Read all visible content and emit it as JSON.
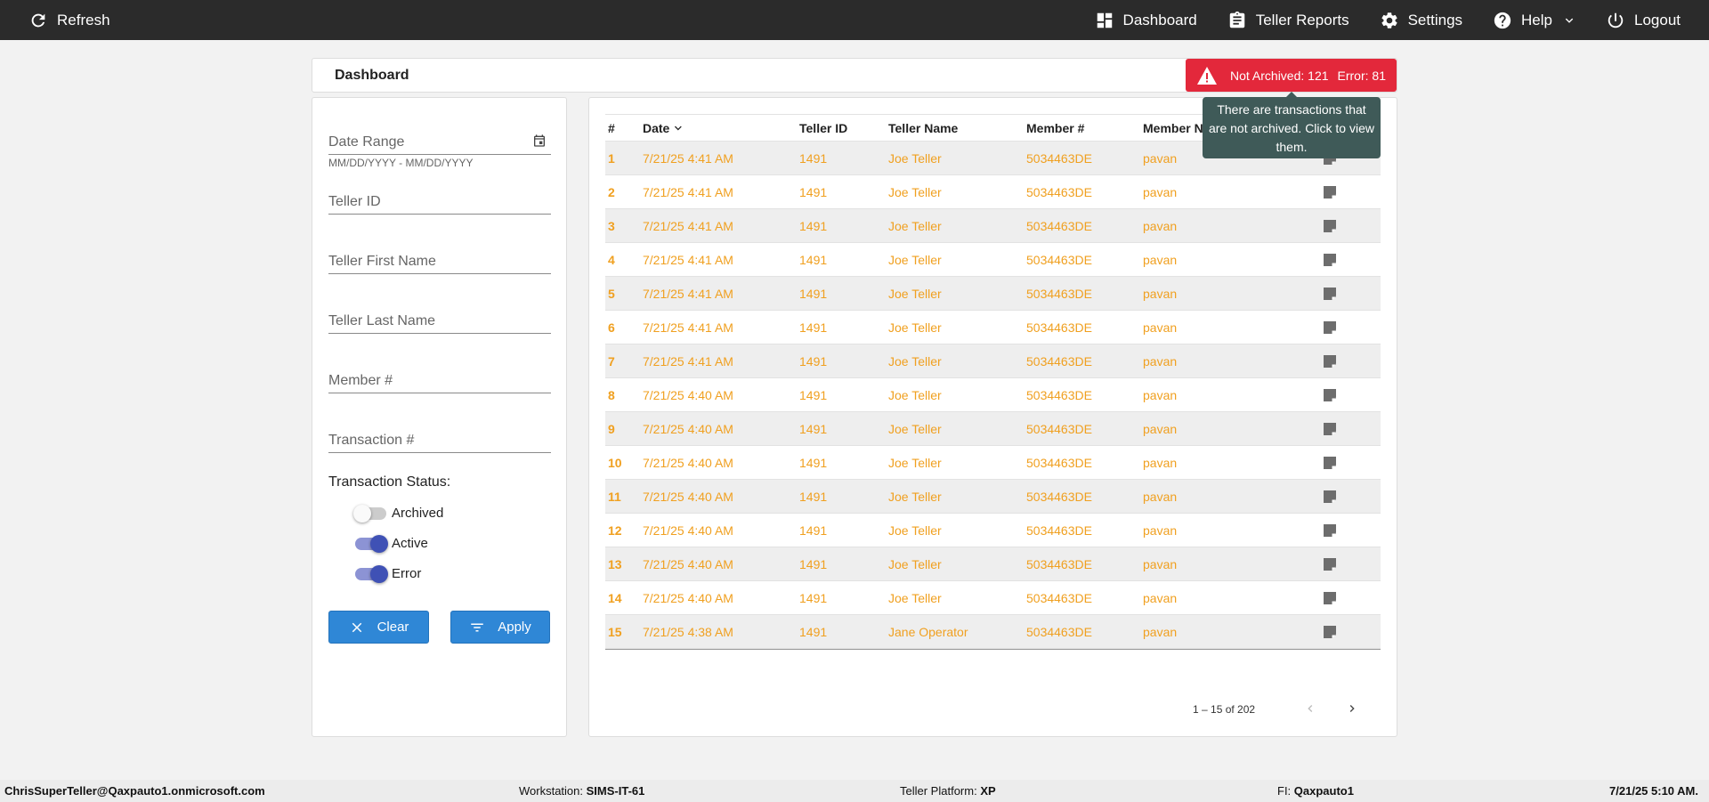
{
  "topbar": {
    "refresh_label": "Refresh",
    "nav": [
      {
        "label": "Dashboard",
        "icon": "dashboard-icon"
      },
      {
        "label": "Teller Reports",
        "icon": "clipboard-icon"
      },
      {
        "label": "Settings",
        "icon": "gear-icon"
      },
      {
        "label": "Help",
        "icon": "help-icon"
      },
      {
        "label": "Logout",
        "icon": "power-icon"
      }
    ]
  },
  "dashboard": {
    "title": "Dashboard",
    "alert": {
      "not_archived": "Not Archived: 121",
      "error": "Error: 81",
      "color": "#e3283b"
    },
    "tooltip": "There are transactions that are not archived. Click to view them."
  },
  "filters": {
    "date_range_placeholder": "Date Range",
    "date_hint": "MM/DD/YYYY - MM/DD/YYYY",
    "teller_id_placeholder": "Teller ID",
    "teller_first_placeholder": "Teller First Name",
    "teller_last_placeholder": "Teller Last Name",
    "member_placeholder": "Member #",
    "transaction_placeholder": "Transaction #",
    "status_label": "Transaction Status:",
    "toggles": [
      {
        "label": "Archived",
        "on": false
      },
      {
        "label": "Active",
        "on": true
      },
      {
        "label": "Error",
        "on": true
      }
    ],
    "clear_label": "Clear",
    "apply_label": "Apply",
    "button_color": "#2f87d6"
  },
  "table": {
    "headers": [
      "#",
      "Date",
      "Teller ID",
      "Teller Name",
      "Member #",
      "Member N"
    ],
    "rows": [
      {
        "num": "1",
        "date": "7/21/25 4:41 AM",
        "teller_id": "1491",
        "teller_name": "Joe Teller",
        "member": "5034463DE",
        "member_name": "pavan"
      },
      {
        "num": "2",
        "date": "7/21/25 4:41 AM",
        "teller_id": "1491",
        "teller_name": "Joe Teller",
        "member": "5034463DE",
        "member_name": "pavan"
      },
      {
        "num": "3",
        "date": "7/21/25 4:41 AM",
        "teller_id": "1491",
        "teller_name": "Joe Teller",
        "member": "5034463DE",
        "member_name": "pavan"
      },
      {
        "num": "4",
        "date": "7/21/25 4:41 AM",
        "teller_id": "1491",
        "teller_name": "Joe Teller",
        "member": "5034463DE",
        "member_name": "pavan"
      },
      {
        "num": "5",
        "date": "7/21/25 4:41 AM",
        "teller_id": "1491",
        "teller_name": "Joe Teller",
        "member": "5034463DE",
        "member_name": "pavan"
      },
      {
        "num": "6",
        "date": "7/21/25 4:41 AM",
        "teller_id": "1491",
        "teller_name": "Joe Teller",
        "member": "5034463DE",
        "member_name": "pavan"
      },
      {
        "num": "7",
        "date": "7/21/25 4:41 AM",
        "teller_id": "1491",
        "teller_name": "Joe Teller",
        "member": "5034463DE",
        "member_name": "pavan"
      },
      {
        "num": "8",
        "date": "7/21/25 4:40 AM",
        "teller_id": "1491",
        "teller_name": "Joe Teller",
        "member": "5034463DE",
        "member_name": "pavan"
      },
      {
        "num": "9",
        "date": "7/21/25 4:40 AM",
        "teller_id": "1491",
        "teller_name": "Joe Teller",
        "member": "5034463DE",
        "member_name": "pavan"
      },
      {
        "num": "10",
        "date": "7/21/25 4:40 AM",
        "teller_id": "1491",
        "teller_name": "Joe Teller",
        "member": "5034463DE",
        "member_name": "pavan"
      },
      {
        "num": "11",
        "date": "7/21/25 4:40 AM",
        "teller_id": "1491",
        "teller_name": "Joe Teller",
        "member": "5034463DE",
        "member_name": "pavan"
      },
      {
        "num": "12",
        "date": "7/21/25 4:40 AM",
        "teller_id": "1491",
        "teller_name": "Joe Teller",
        "member": "5034463DE",
        "member_name": "pavan"
      },
      {
        "num": "13",
        "date": "7/21/25 4:40 AM",
        "teller_id": "1491",
        "teller_name": "Joe Teller",
        "member": "5034463DE",
        "member_name": "pavan"
      },
      {
        "num": "14",
        "date": "7/21/25 4:40 AM",
        "teller_id": "1491",
        "teller_name": "Joe Teller",
        "member": "5034463DE",
        "member_name": "pavan"
      },
      {
        "num": "15",
        "date": "7/21/25 4:38 AM",
        "teller_id": "1491",
        "teller_name": "Jane Operator",
        "member": "5034463DE",
        "member_name": "pavan"
      }
    ],
    "row_text_color": "#f0a020",
    "pagination": "1 – 15 of 202"
  },
  "footer": {
    "user": "ChrisSuperTeller@Qaxpauto1.onmicrosoft.com",
    "workstation_label": "Workstation:",
    "workstation": "SIMS-IT-61",
    "platform_label": "Teller Platform:",
    "platform": "XP",
    "fi_label": "FI:",
    "fi": "Qaxpauto1",
    "datetime": "7/21/25 5:10 AM."
  }
}
